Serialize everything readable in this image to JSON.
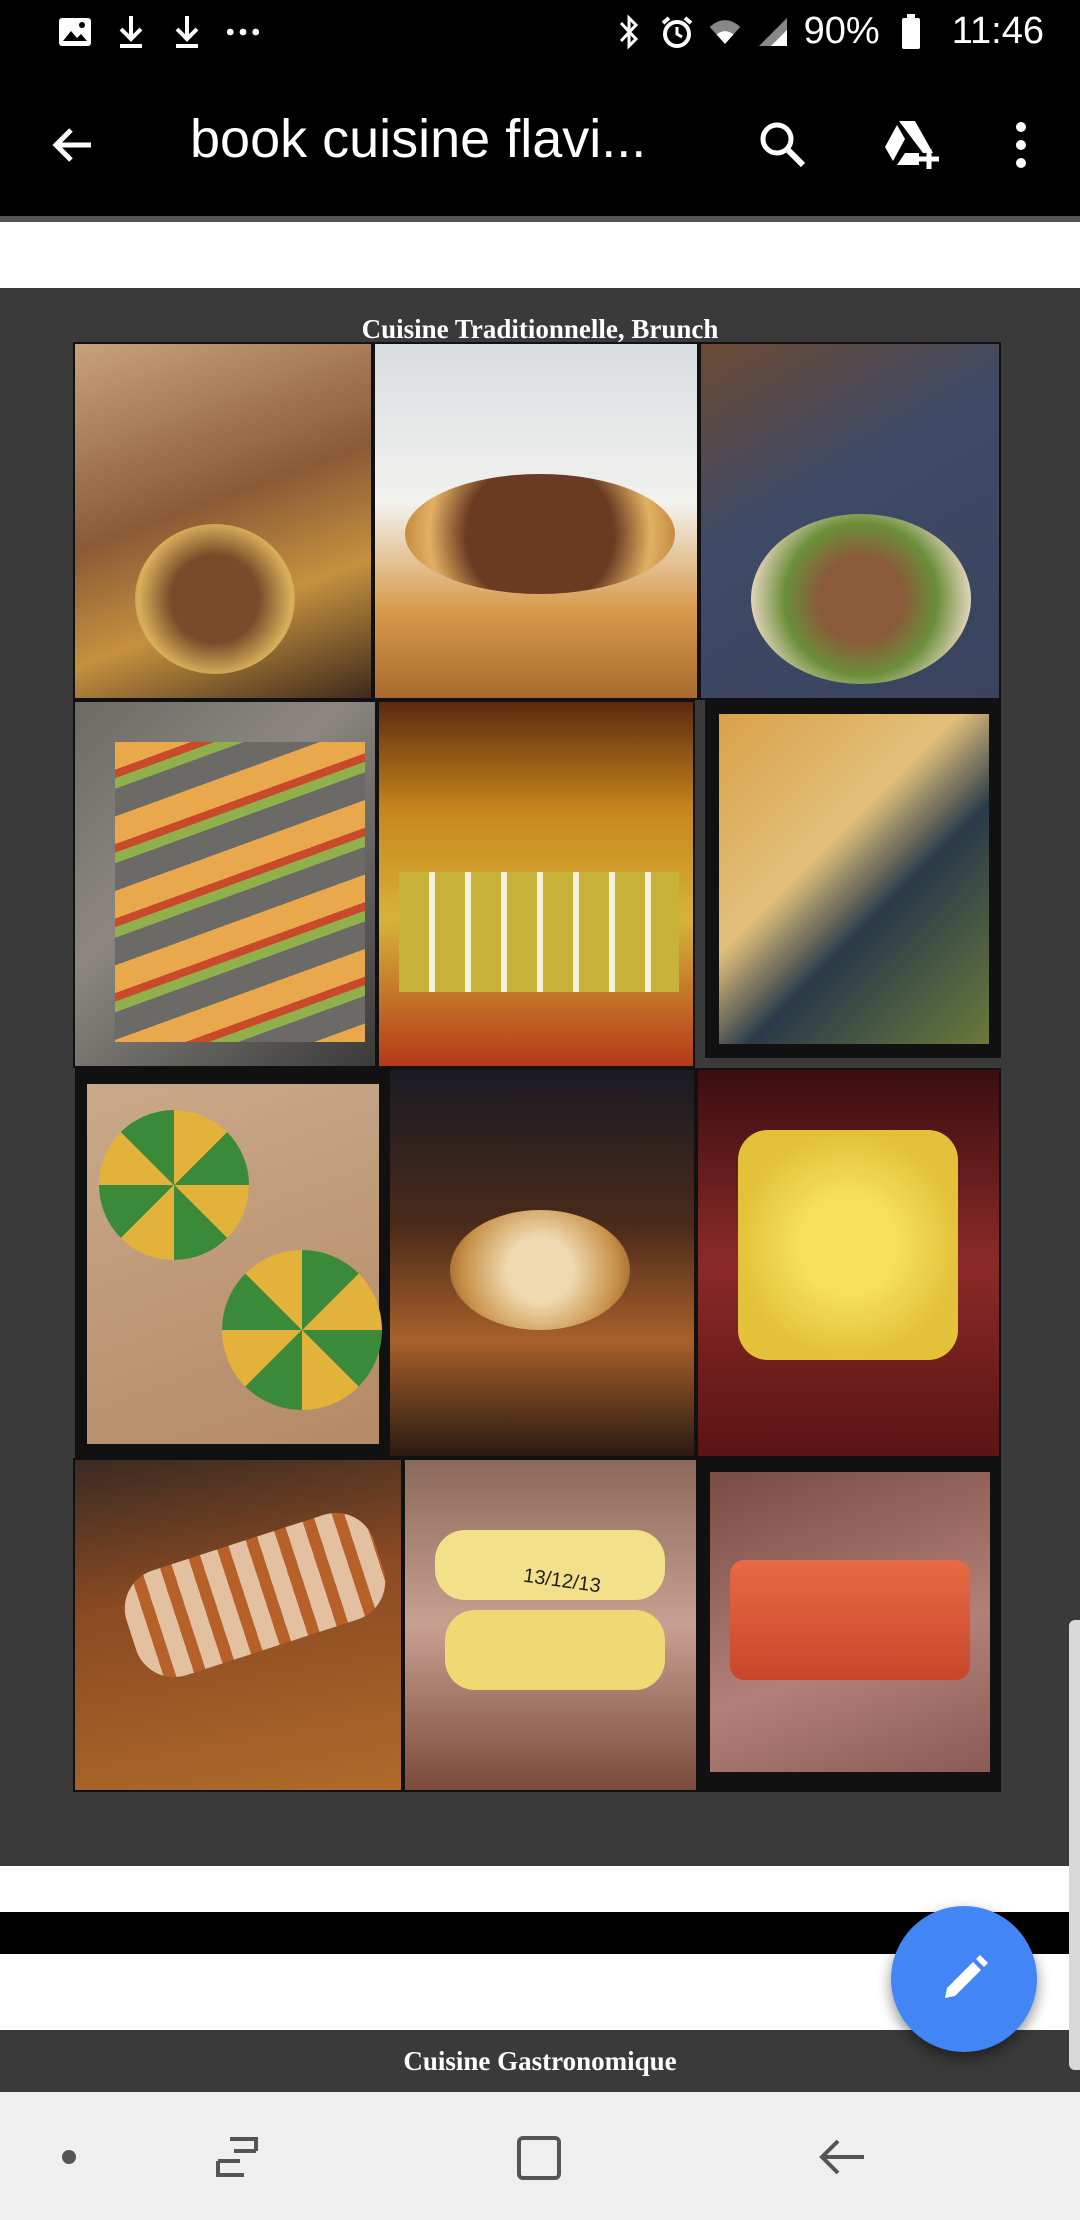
{
  "status_bar": {
    "battery": "90%",
    "time": "11:46",
    "left_icons": [
      "image-icon",
      "download-icon",
      "download-icon",
      "more-notifications-icon"
    ],
    "right_icons": [
      "bluetooth-icon",
      "alarm-icon",
      "wifi-icon",
      "signal-icon",
      "battery-icon"
    ]
  },
  "app_bar": {
    "title": "book cuisine flavi...",
    "icons": [
      "back-arrow-icon",
      "search-icon",
      "drive-add-icon",
      "more-vert-icon"
    ]
  },
  "document": {
    "page1_heading": "Cuisine Traditionnelle, Brunch",
    "page2_heading": "Cuisine Gastronomique",
    "photo_labels": [
      "13/12/13"
    ]
  },
  "fab": {
    "icon": "edit-pencil-icon",
    "color": "#4285f4"
  },
  "nav_bar": {
    "icons": [
      "dot-icon",
      "recent-apps-icon",
      "home-icon",
      "back-icon"
    ]
  },
  "colors": {
    "page_bg": "#3a3a3a",
    "accent": "#4285f4"
  }
}
